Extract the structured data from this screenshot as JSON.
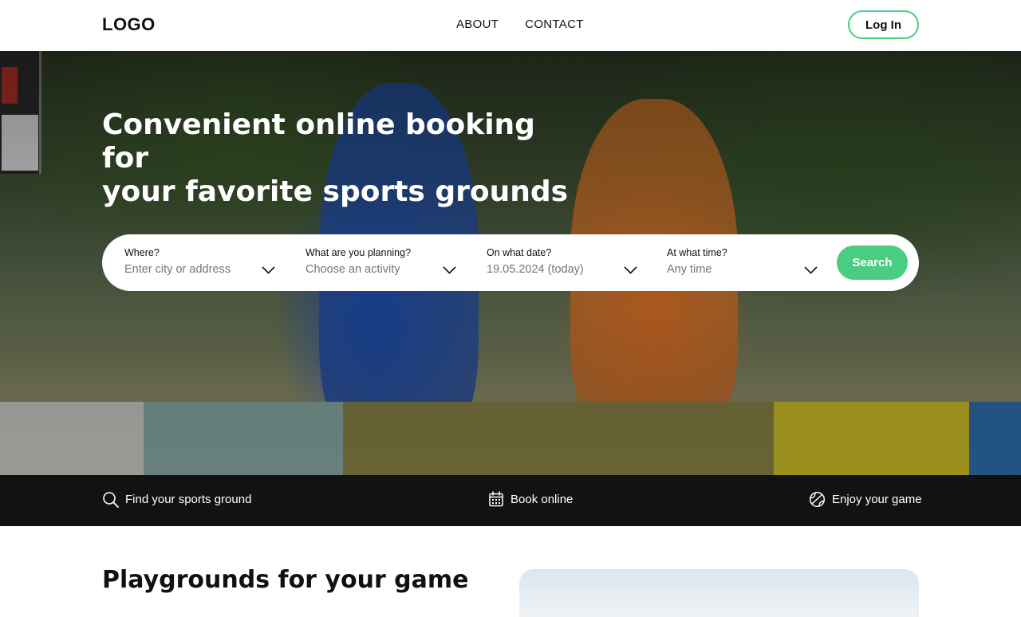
{
  "header": {
    "logo": "LOGO",
    "nav": [
      "ABOUT",
      "CONTACT"
    ],
    "login_label": "Log In"
  },
  "hero": {
    "title_line1": "Convenient online booking for",
    "title_line2": "your favorite sports grounds"
  },
  "search": {
    "fields": [
      {
        "label": "Where?",
        "placeholder": "Enter city or address"
      },
      {
        "label": "What are you planning?",
        "placeholder": "Choose an activity"
      },
      {
        "label": "On what date?",
        "value": "19.05.2024 (today)"
      },
      {
        "label": "At what time?",
        "value": "Any time"
      }
    ],
    "button_label": "Search"
  },
  "steps": [
    {
      "icon": "search-icon",
      "label": "Find your sports ground"
    },
    {
      "icon": "calendar-icon",
      "label": "Book online"
    },
    {
      "icon": "ball-icon",
      "label": "Enjoy your game"
    }
  ],
  "section": {
    "title": "Playgrounds for your game"
  },
  "colors": {
    "accent": "#49cd83",
    "dark_band": "#121212",
    "placeholder": "#757575"
  }
}
